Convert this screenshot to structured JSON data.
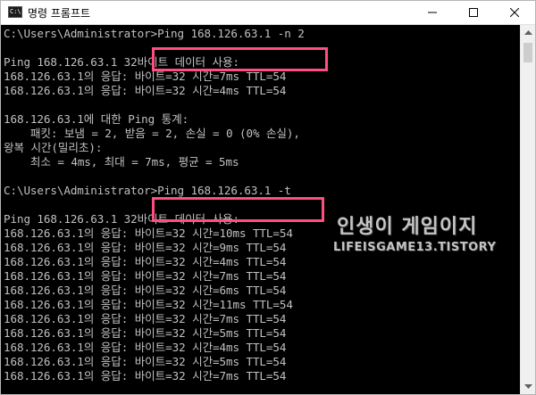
{
  "window": {
    "icon_text": "C:\\",
    "title": "명령 프롬프트",
    "buttons": {
      "minimize": "minimize",
      "maximize": "maximize",
      "close": "close"
    }
  },
  "console": {
    "lines": [
      "C:\\Users\\Administrator>Ping 168.126.63.1 -n 2",
      "",
      "Ping 168.126.63.1 32바이트 데이터 사용:",
      "168.126.63.1의 응답: 바이트=32 시간=7ms TTL=54",
      "168.126.63.1의 응답: 바이트=32 시간=4ms TTL=54",
      "",
      "168.126.63.1에 대한 Ping 통계:",
      "    패킷: 보냄 = 2, 받음 = 2, 손실 = 0 (0% 손실),",
      "왕복 시간(밀리초):",
      "    최소 = 4ms, 최대 = 7ms, 평균 = 5ms",
      "",
      "C:\\Users\\Administrator>Ping 168.126.63.1 -t",
      "",
      "Ping 168.126.63.1 32바이트 데이터 사용:",
      "168.126.63.1의 응답: 바이트=32 시간=10ms TTL=54",
      "168.126.63.1의 응답: 바이트=32 시간=9ms TTL=54",
      "168.126.63.1의 응답: 바이트=32 시간=4ms TTL=54",
      "168.126.63.1의 응답: 바이트=32 시간=7ms TTL=54",
      "168.126.63.1의 응답: 바이트=32 시간=6ms TTL=54",
      "168.126.63.1의 응답: 바이트=32 시간=11ms TTL=54",
      "168.126.63.1의 응답: 바이트=32 시간=7ms TTL=54",
      "168.126.63.1의 응답: 바이트=32 시간=5ms TTL=54",
      "168.126.63.1의 응답: 바이트=32 시간=4ms TTL=54",
      "168.126.63.1의 응답: 바이트=32 시간=5ms TTL=54",
      "168.126.63.1의 응답: 바이트=32 시간=7ms TTL=54"
    ]
  },
  "watermark": {
    "title": "인생이 게임이지",
    "subtitle": "LIFEISGAME13.TISTORY"
  },
  "colors": {
    "console_bg": "#000000",
    "console_text": "#c0c0c0",
    "highlight": "#ff4f81"
  }
}
